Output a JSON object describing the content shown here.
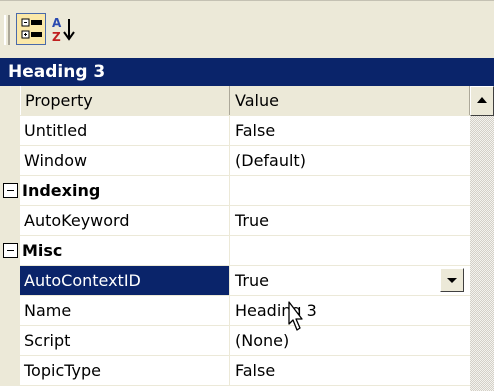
{
  "toolbar": {
    "categorized_icon": "categorized-view-icon",
    "alphabetical_icon": "sort-alphabetical-icon"
  },
  "heading": {
    "title": "Heading 3"
  },
  "grid": {
    "header": {
      "property": "Property",
      "value": "Value"
    },
    "rows": [
      {
        "kind": "property",
        "name": "Untitled",
        "value": "False"
      },
      {
        "kind": "property",
        "name": "Window",
        "value": "(Default)"
      },
      {
        "kind": "category",
        "name": "Indexing",
        "value": ""
      },
      {
        "kind": "property",
        "name": "AutoKeyword",
        "value": "True"
      },
      {
        "kind": "category",
        "name": "Misc",
        "value": ""
      },
      {
        "kind": "property",
        "name": "AutoContextID",
        "value": "True",
        "selected": true
      },
      {
        "kind": "property",
        "name": "Name",
        "value": "Heading 3"
      },
      {
        "kind": "property",
        "name": "Script",
        "value": "(None)"
      },
      {
        "kind": "property",
        "name": "TopicType",
        "value": "False"
      }
    ]
  },
  "colors": {
    "selection": "#0a246a",
    "chrome": "#ece9d8"
  }
}
